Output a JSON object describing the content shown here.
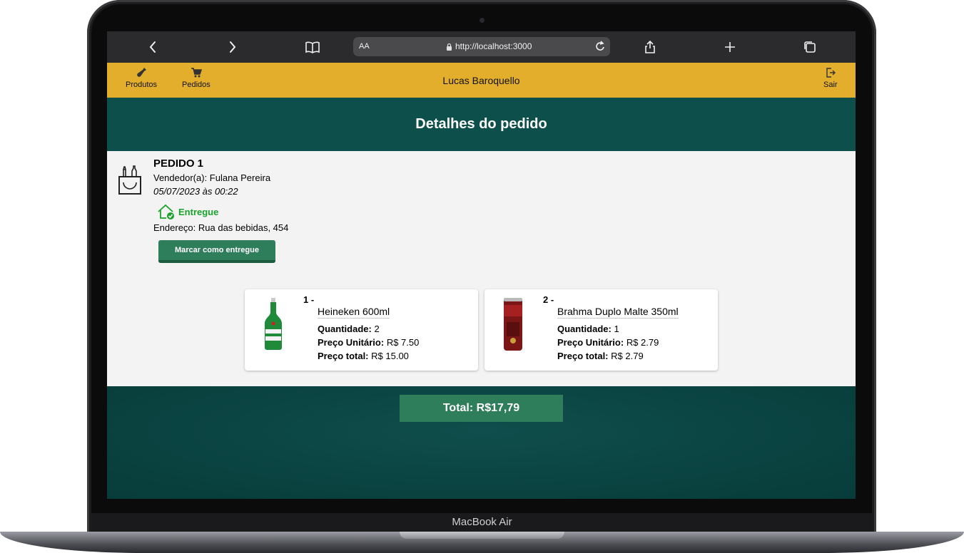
{
  "device": {
    "label": "MacBook Air"
  },
  "browser": {
    "text_size": "AA",
    "url": "http://localhost:3000"
  },
  "nav": {
    "products_label": "Produtos",
    "orders_label": "Pedidos",
    "user_name": "Lucas Baroquello",
    "logout_label": "Sair"
  },
  "page": {
    "title": "Detalhes do pedido"
  },
  "order": {
    "title": "PEDIDO 1",
    "seller": "Vendedor(a): Fulana Pereira",
    "date": "05/07/2023 às 00:22",
    "status": "Entregue",
    "address": "Endereço: Rua das bebidas, 454",
    "mark_delivered_label": "Marcar como entregue"
  },
  "items": [
    {
      "index": "1 -",
      "name": "Heineken 600ml",
      "qty_label": "Quantidade:",
      "qty": "2",
      "unit_label": "Preço Unitário:",
      "unit_price": "R$ 7.50",
      "total_label": "Preço total:",
      "total": "R$ 15.00"
    },
    {
      "index": "2 -",
      "name": "Brahma Duplo Malte 350ml",
      "qty_label": "Quantidade:",
      "qty": "1",
      "unit_label": "Preço Unitário:",
      "unit_price": "R$ 2.79",
      "total_label": "Preço total:",
      "total": "R$ 2.79"
    }
  ],
  "summary": {
    "total": "Total: R$17,79"
  },
  "colors": {
    "nav_bg": "#e3ae2c",
    "band_bg": "#0d4f4b",
    "accent_green": "#2e7d5b",
    "status_green": "#1aa32a"
  }
}
